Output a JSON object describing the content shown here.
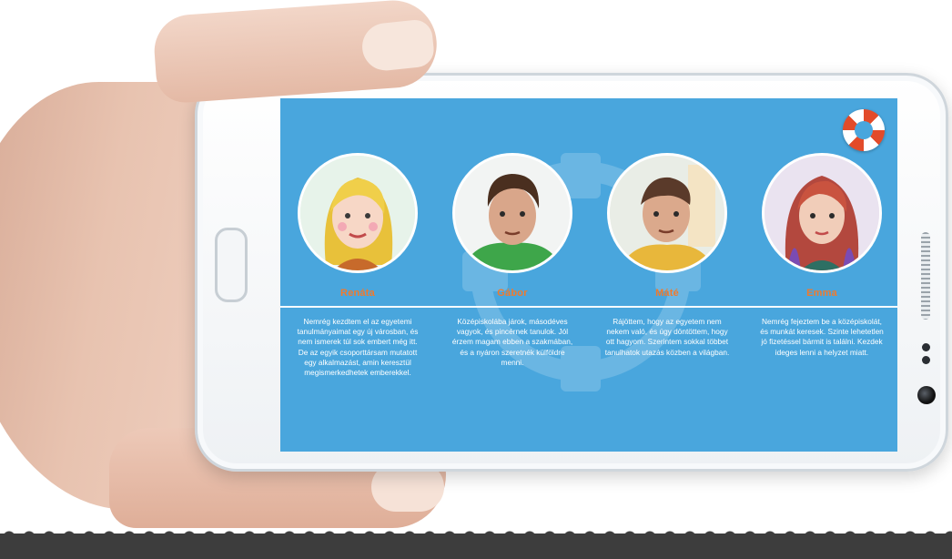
{
  "app": {
    "help_icon": "lifebuoy-icon",
    "colors": {
      "screen_bg": "#49a6dd",
      "name_color": "#f07a2d",
      "text_color": "#ffffff"
    }
  },
  "characters": [
    {
      "name": "Renáta",
      "description": "Nemrég kezdtem el az egyetemi tanulmányaimat egy új városban, és nem ismerek túl sok embert még itt. De az egyik csoporttársam mutatott egy alkalmazást, amin keresztül megismerkedhetek emberekkel."
    },
    {
      "name": "Gábor",
      "description": "Középiskolába járok, másodéves vagyok, és pincérnek tanulok. Jól érzem magam ebben a szakmában, és a nyáron szeretnék külföldre menni."
    },
    {
      "name": "Máté",
      "description": "Rájöttem, hogy az egyetem nem nekem való, és úgy döntöttem, hogy ott hagyom. Szerintem sokkal többet tanulhatok utazás közben a világban."
    },
    {
      "name": "Emma",
      "description": "Nemrég fejeztem be a középiskolát, és munkát keresek. Szinte lehetetlen jó fizetéssel bármit is találni. Kezdek ideges lenni a helyzet miatt."
    }
  ]
}
